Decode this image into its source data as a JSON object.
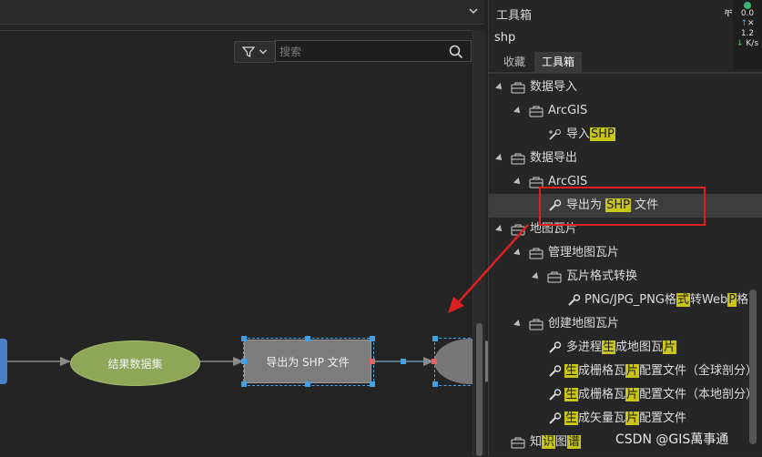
{
  "canvas": {
    "search_placeholder": "搜索",
    "nodes": {
      "result_dataset": "结果数据集",
      "export_shp": "导出为 SHP 文件"
    }
  },
  "panel": {
    "title": "工具箱",
    "pin": "ቸ",
    "close": "✕",
    "search_value": "shp",
    "tabs": [
      {
        "label": "收藏"
      },
      {
        "label": "工具箱"
      }
    ],
    "tree": {
      "data_import": "数据导入",
      "arcgis_1": "ArcGIS",
      "import_pre": "导入",
      "import_hl": "SHP",
      "data_export": "数据导出",
      "arcgis_2": "ArcGIS",
      "export_pre": "导出为 ",
      "export_hl": "SHP",
      "export_post": " 文件",
      "map_tiles": "地图瓦片",
      "manage_tiles": "管理地图瓦片",
      "tile_format": "瓦片格式转换",
      "png_a": "PNG/JPG_PNG格",
      "png_hl1": "式",
      "png_b": "转Web",
      "png_hl2": "P",
      "png_c": "格",
      "create_tiles": "创建地图瓦片",
      "mp_a": "多进程",
      "mp_hl1": "生",
      "mp_b": "成地图瓦",
      "mp_hl2": "片",
      "rg_hl1": "生",
      "rg_a": "成栅格瓦",
      "rg_hl2": "片",
      "rg_b": "配置文件（全球剖分）",
      "rl_hl1": "生",
      "rl_a": "成栅格瓦",
      "rl_hl2": "片",
      "rl_b": "配置文件（本地剖分）",
      "vc_hl1": "生",
      "vc_a": "成矢量瓦",
      "vc_hl2": "片",
      "vc_b": "配置文件",
      "kg_a": "知",
      "kg_hl1": "识",
      "kg_b": "图",
      "kg_hl2": "谱"
    }
  },
  "network": {
    "top": "0.0",
    "up_value": "1.2",
    "up_arrow": "↑",
    "down_arrow": "↓",
    "unit": "K/s"
  },
  "watermark": "CSDN @GIS萬事通"
}
